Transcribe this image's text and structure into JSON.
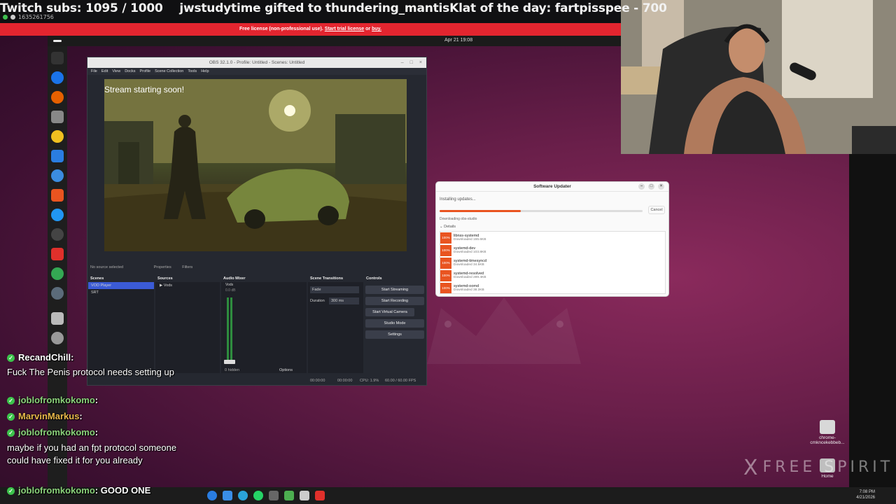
{
  "overlay": {
    "sub_count": "Twitch subs: 1095 / 1000",
    "gift_message": "jwstudytime gifted to thundering_mantisKlat of the day: fartpisspee - 700",
    "viewer_id": "1635261756",
    "license_text": "Free license (non-professional use).",
    "license_trial": "Start trial license",
    "license_or": "or",
    "license_buy": "buy."
  },
  "desktop": {
    "date": "Apr 21  19:08"
  },
  "obs": {
    "title": "OBS 32.1.0 - Profile: Untitled - Scenes: Untitled",
    "menu": [
      "File",
      "Edit",
      "View",
      "Docks",
      "Profile",
      "Scene Collection",
      "Tools",
      "Help"
    ],
    "preview_text": "Stream starting soon!",
    "no_source": "No source selected",
    "properties": "Properties",
    "filters": "Filters",
    "docks": {
      "scenes": "Scenes",
      "sources": "Sources",
      "audio_mixer": "Audio Mixer",
      "scene_transitions": "Scene Transitions",
      "controls": "Controls"
    },
    "scenes": [
      "VOD Player",
      "SRT"
    ],
    "sources": [
      "Vods"
    ],
    "mixer": {
      "channel": "Vods",
      "level": "0.0 dB",
      "hidden": "0 hidden"
    },
    "transition": {
      "type": "Fade",
      "duration_label": "Duration",
      "duration_value": "300 ms"
    },
    "controls": [
      "Start Streaming",
      "Start Recording",
      "Start Virtual Camera",
      "Studio Mode",
      "Settings"
    ],
    "options": "Options",
    "status": {
      "stream_time": "00:00:00",
      "rec_time": "00:00:00",
      "cpu": "CPU: 1.9%",
      "fps": "60.00 / 60.00 FPS"
    }
  },
  "updater": {
    "title": "Software Updater",
    "status": "Installing updates...",
    "progress": 0.4,
    "cancel": "Cancel",
    "downloading": "Downloading obs-studio",
    "details": "Details",
    "packages": [
      {
        "pct": "100%",
        "name": "libnss-systemd",
        "size": "Downloaded 155.6KB"
      },
      {
        "pct": "100%",
        "name": "systemd-dev",
        "size": "Downloaded 103.8KB"
      },
      {
        "pct": "100%",
        "name": "systemd-timesyncd",
        "size": "Downloaded 34.5KB"
      },
      {
        "pct": "100%",
        "name": "systemd-resolved",
        "size": "Downloaded 289.4KB"
      },
      {
        "pct": "100%",
        "name": "systemd-oomd",
        "size": "Downloaded 38.3KB"
      }
    ]
  },
  "chat": {
    "messages": [
      {
        "user": "RecandChill",
        "text": "Fuck The Penis protocol needs setting up",
        "color": "#ffffff"
      },
      {
        "user": "joblofromkokomo",
        "text": "",
        "color": "#8ad17a"
      },
      {
        "user": "MarvinMarkus",
        "text": "",
        "color": "#e8b84a"
      },
      {
        "user": "joblofromkokomo",
        "text": "maybe if you had an fpt protocol someone could have fixed it for you already",
        "color": "#8ad17a"
      },
      {
        "user": "joblofromkokomo",
        "text": "GOOD ONE",
        "color": "#8ad17a"
      }
    ]
  },
  "desktop_icons": [
    {
      "label": "chrome-cmkncekebbeb..."
    },
    {
      "label": "Home"
    }
  ],
  "watermark": {
    "mark": "X",
    "text": "FREE SPIRIT"
  },
  "taskbar": {
    "time": "7:08 PM",
    "date": "4/21/2026"
  }
}
